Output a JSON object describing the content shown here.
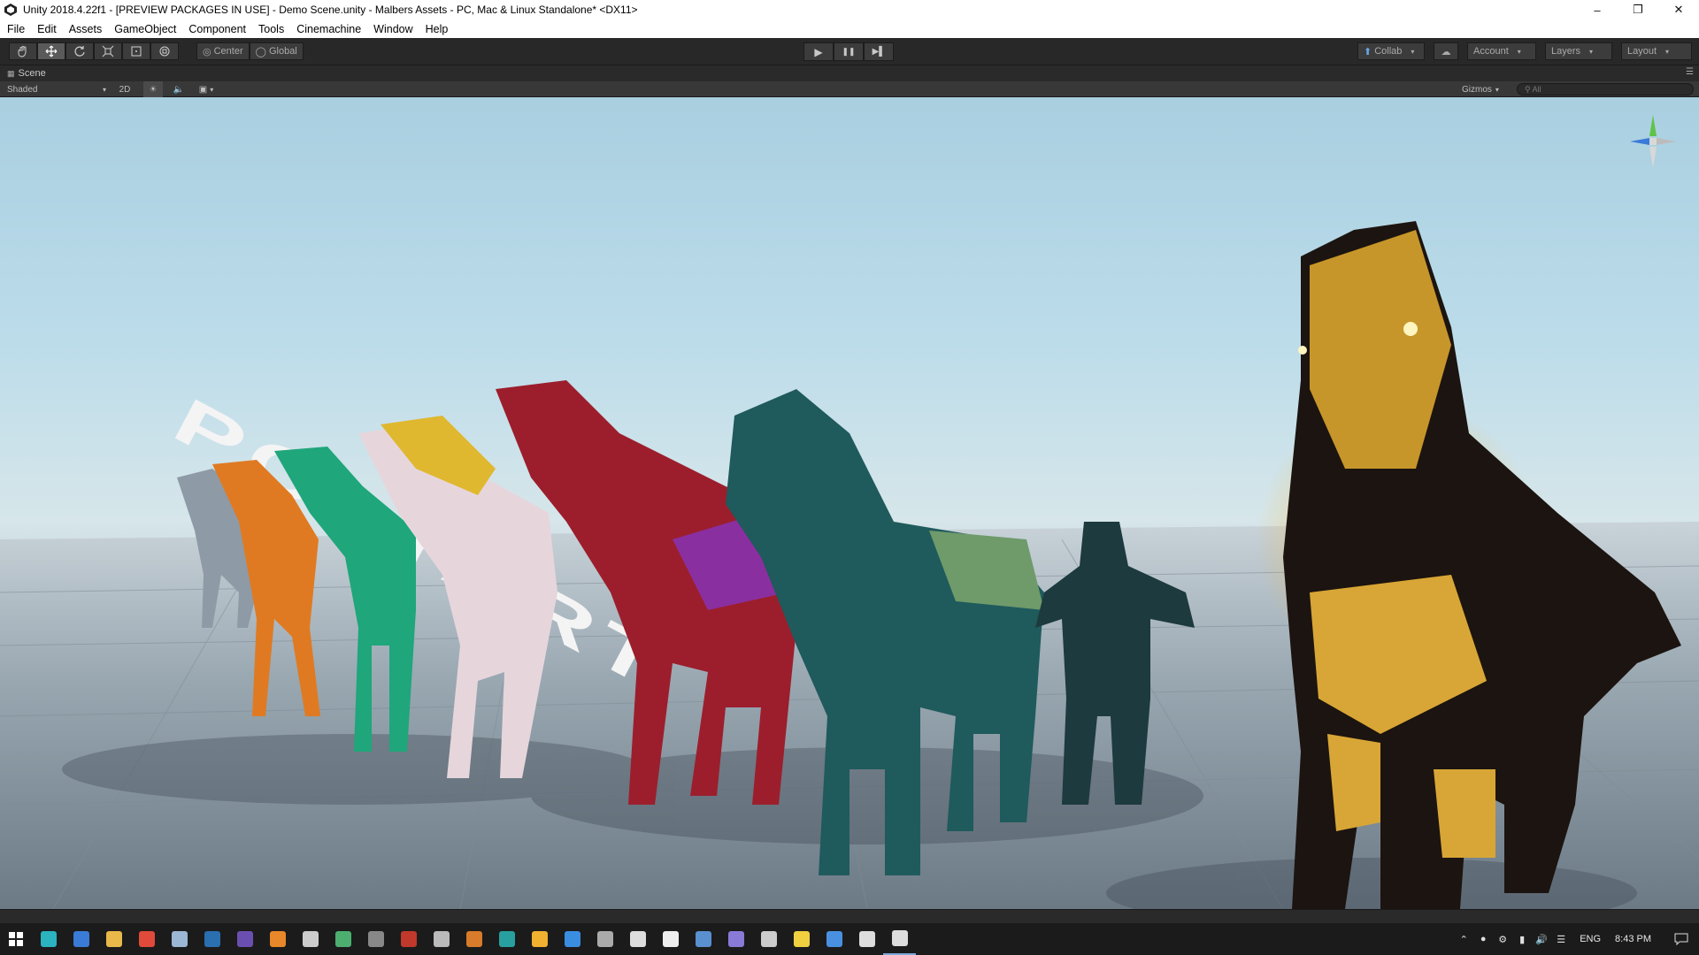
{
  "window": {
    "title": "Unity 2018.4.22f1 - [PREVIEW PACKAGES IN USE] - Demo Scene.unity - Malbers Assets - PC, Mac & Linux Standalone* <DX11>",
    "minimize": "–",
    "maximize": "❐",
    "close": "✕"
  },
  "menu": [
    "File",
    "Edit",
    "Assets",
    "GameObject",
    "Component",
    "Tools",
    "Cinemachine",
    "Window",
    "Help"
  ],
  "toolbar": {
    "tools": [
      "hand-tool",
      "move-tool",
      "rotate-tool",
      "scale-tool",
      "rect-tool",
      "transform-tool"
    ],
    "active_tool": "move-tool",
    "pivot_mode": "Center",
    "pivot_rotation": "Global",
    "play_icon": "▶",
    "pause_icon": "❚❚",
    "step_icon": "▶▌",
    "collab": "Collab",
    "account": "Account",
    "layers": "Layers",
    "layout": "Layout",
    "caret": "▾"
  },
  "scene": {
    "tab_label": "Scene",
    "shading_mode": "Shaded",
    "mode_2d": "2D",
    "gizmos": "Gizmos",
    "search_placeholder": "All",
    "floor_text": "POLYART"
  },
  "taskbar": {
    "language": "ENG",
    "time": "8:43 PM",
    "apps": [
      {
        "name": "store",
        "color": "#2bb3c0"
      },
      {
        "name": "save-disk",
        "color": "#3a7bd5"
      },
      {
        "name": "file-explorer",
        "color": "#e8b84a"
      },
      {
        "name": "chrome",
        "color": "#e04a3a"
      },
      {
        "name": "steam",
        "color": "#9cb6d6"
      },
      {
        "name": "photoshop",
        "color": "#2a6fb0"
      },
      {
        "name": "after-effects",
        "color": "#6b4fb0"
      },
      {
        "name": "blender",
        "color": "#e8882a"
      },
      {
        "name": "epic-games",
        "color": "#cccccc"
      },
      {
        "name": "app-green",
        "color": "#4caf70"
      },
      {
        "name": "terminal",
        "color": "#888888"
      },
      {
        "name": "app-red",
        "color": "#c0392b"
      },
      {
        "name": "calculator",
        "color": "#bbbbbb"
      },
      {
        "name": "app-orange",
        "color": "#d87b2a"
      },
      {
        "name": "app-teal",
        "color": "#29a0a0"
      },
      {
        "name": "chrome-alt",
        "color": "#f0b030"
      },
      {
        "name": "app-blue",
        "color": "#3a8ee0"
      },
      {
        "name": "github",
        "color": "#aaaaaa"
      },
      {
        "name": "app-pen",
        "color": "#dddddd"
      },
      {
        "name": "x-app",
        "color": "#eeeeee"
      },
      {
        "name": "downloads",
        "color": "#5a8fd0"
      },
      {
        "name": "app-circle",
        "color": "#8a7ad8"
      },
      {
        "name": "app-mic",
        "color": "#cccccc"
      },
      {
        "name": "sticky-notes",
        "color": "#f0d040"
      },
      {
        "name": "save-disk-2",
        "color": "#4a90e0"
      },
      {
        "name": "app-doc",
        "color": "#dddddd"
      },
      {
        "name": "unity",
        "color": "#dddddd"
      }
    ],
    "running_app": "unity"
  }
}
